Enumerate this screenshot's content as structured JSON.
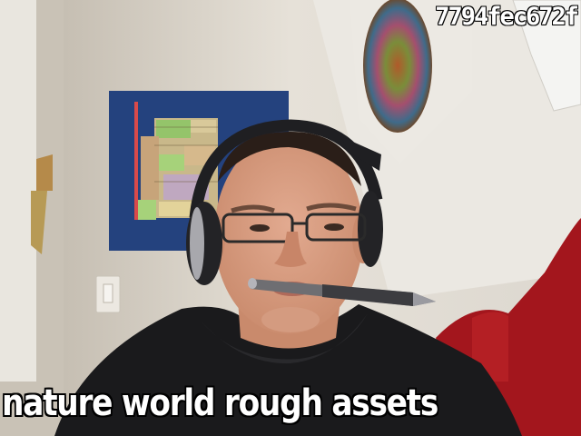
{
  "overlay": {
    "hash_text": "7794fec672f",
    "caption_text": "nature world rough assets"
  },
  "colors": {
    "wall": "#e3ded6",
    "poster_blue": "#24427e",
    "hoodie": "#1a1a1c",
    "couch_red": "#a3161d",
    "skin": "#d9a084"
  }
}
